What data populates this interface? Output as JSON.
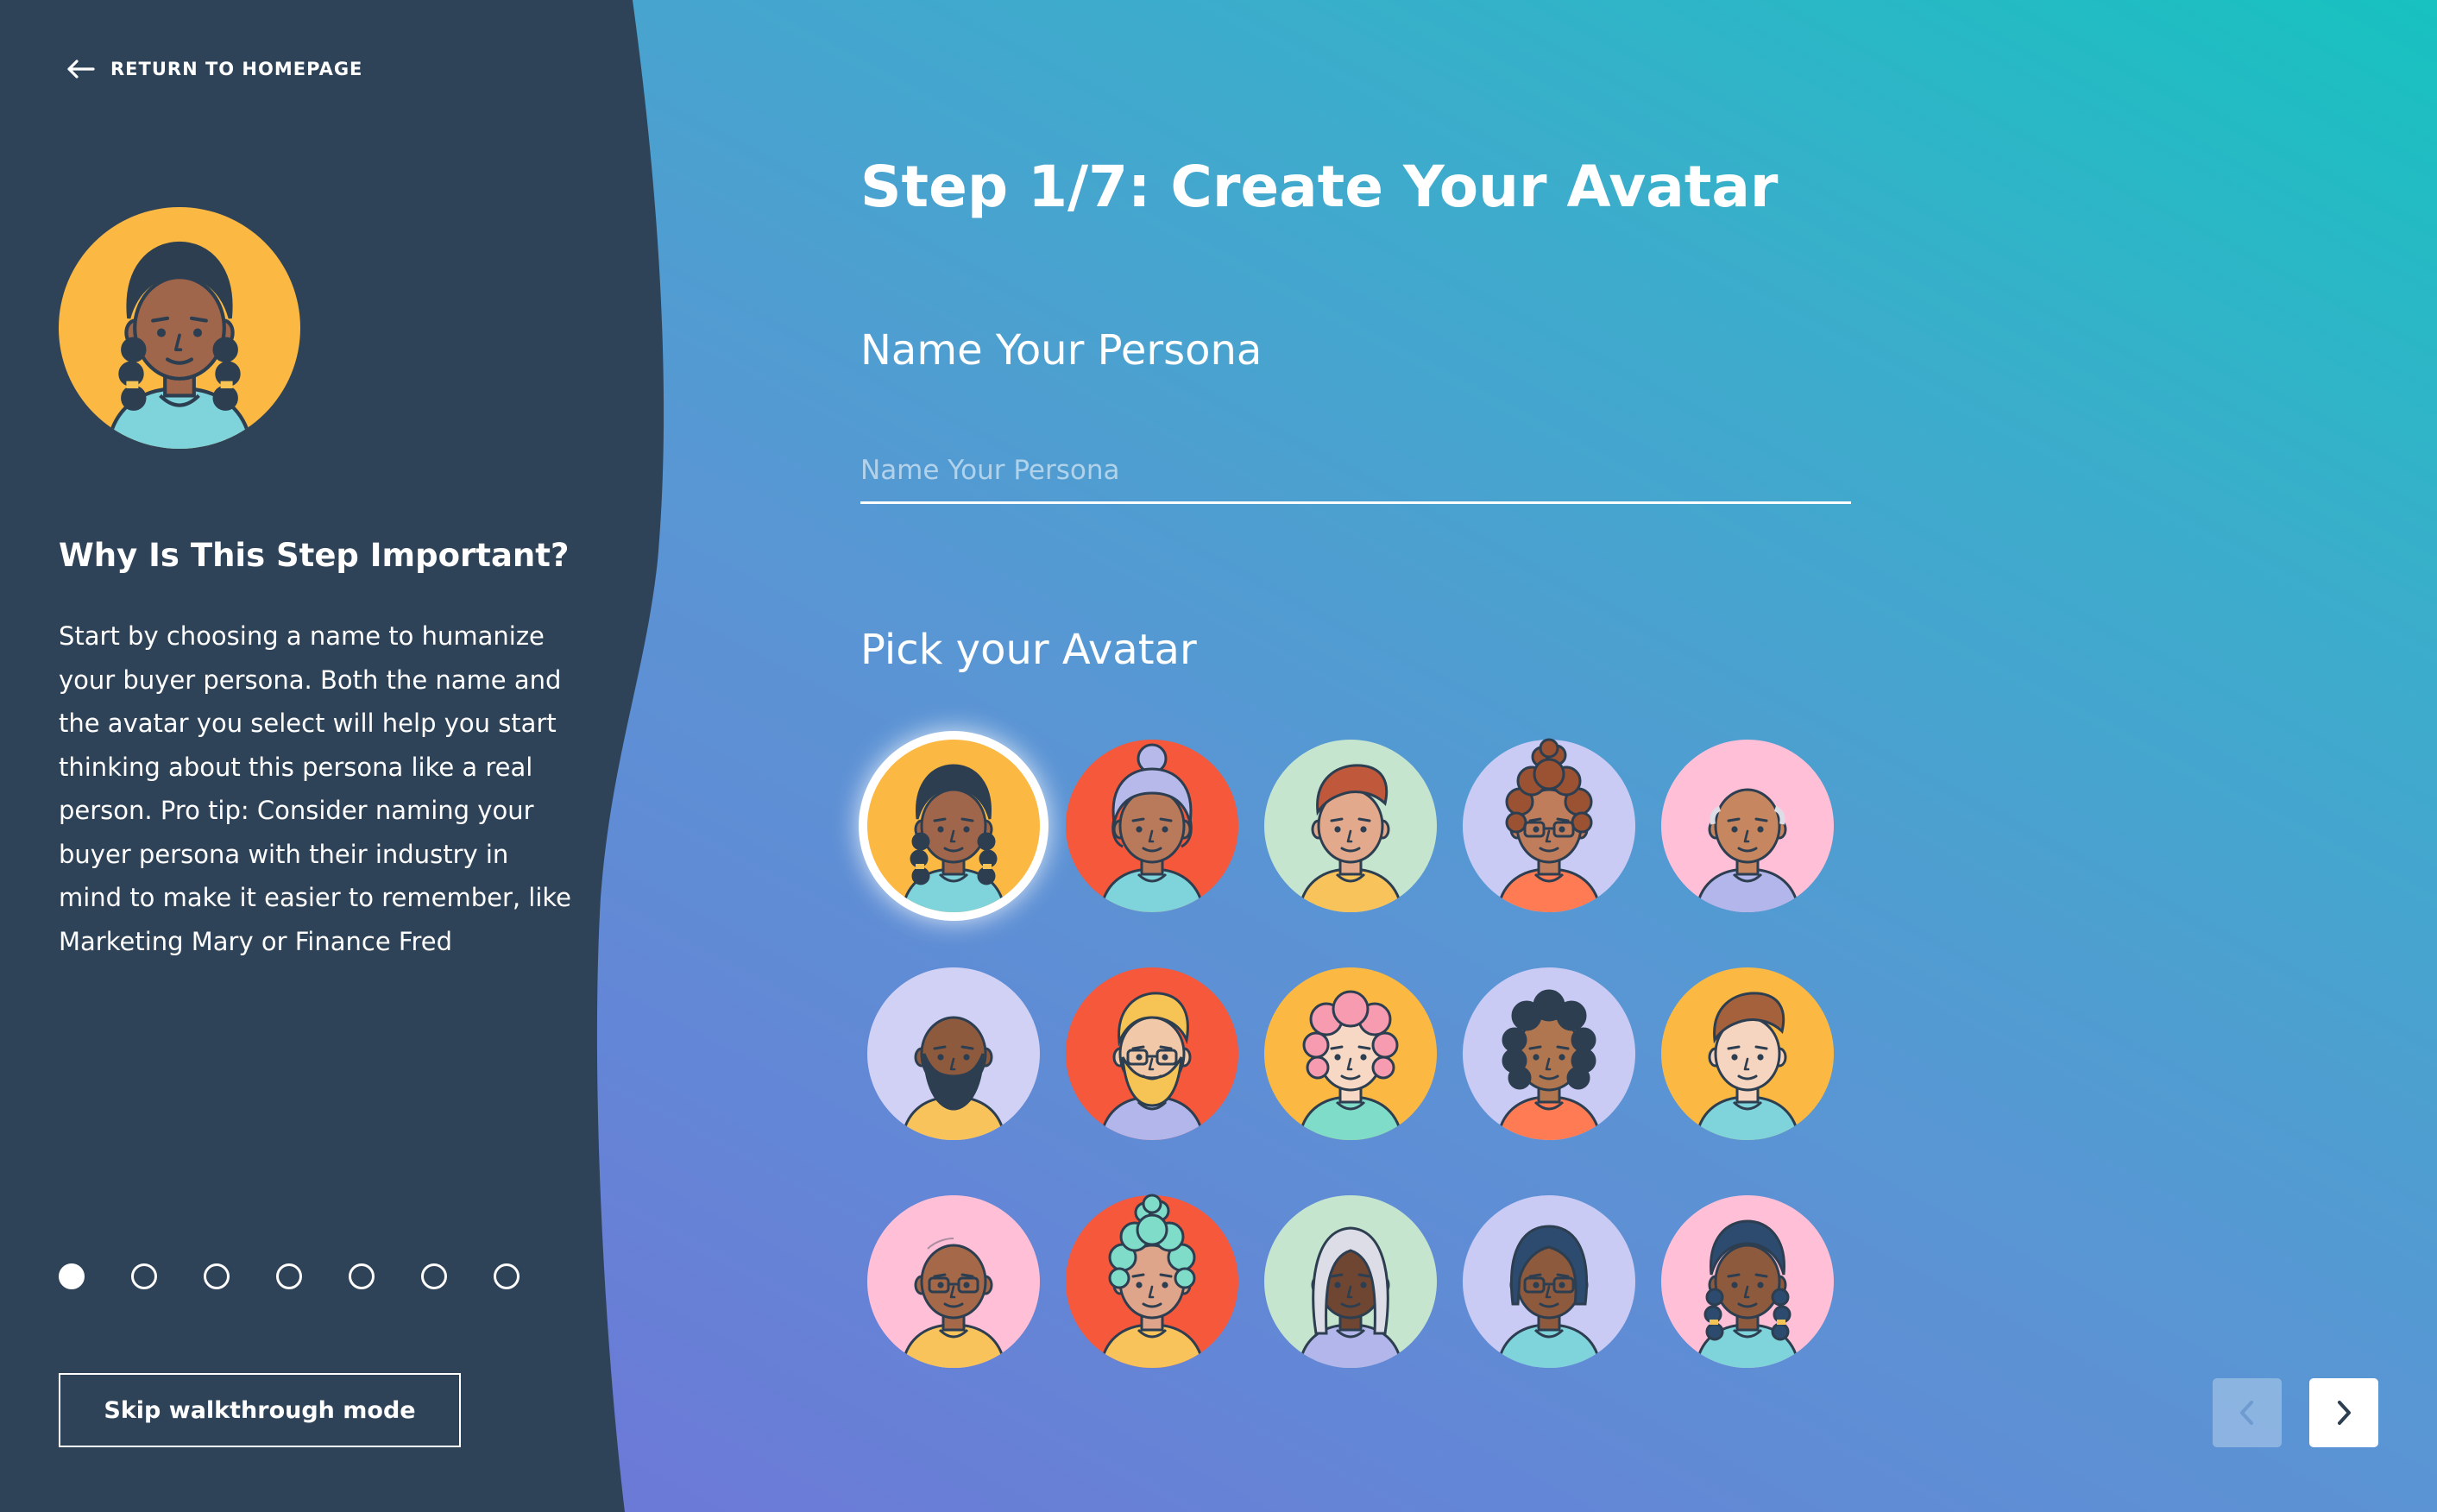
{
  "nav": {
    "return_label": "RETURN TO HOMEPAGE"
  },
  "sidebar": {
    "heading": "Why Is This Step Important?",
    "body": "Start by choosing a name to humanize your buyer persona. Both the name and the avatar you select will help you start thinking about this persona like a real person. Pro tip: Consider naming your buyer persona with their industry in mind to make it easier to remember, like Marketing Mary or Finance Fred",
    "steps_total": 7,
    "current_step": 1,
    "skip_label": "Skip walkthrough mode"
  },
  "main": {
    "title": "Step 1/7: Create Your Avatar",
    "name_heading": "Name Your Persona",
    "name_placeholder": "Name Your Persona",
    "name_value": "",
    "avatar_heading": "Pick your Avatar",
    "selected_avatar": 0,
    "avatars": [
      {
        "name": "avatar-braids-teal",
        "bg": "#fbb943",
        "skin": "#a0664b",
        "shirt": "#7fd3da",
        "hair": "#2c3e50",
        "style": "braids"
      },
      {
        "name": "avatar-gray-bun",
        "bg": "#f5583b",
        "skin": "#b97a5c",
        "shirt": "#7fd3da",
        "hair": "#b7b9eb",
        "style": "bun"
      },
      {
        "name": "avatar-red-quiff",
        "bg": "#c6e5cf",
        "skin": "#e2a98c",
        "shirt": "#f8c35b",
        "hair": "#c0583c",
        "style": "quiff"
      },
      {
        "name": "avatar-curly-glasses",
        "bg": "#c9cbf4",
        "skin": "#c07d5b",
        "shirt": "#ff7b54",
        "hair": "#9a5232",
        "style": "curlybun"
      },
      {
        "name": "avatar-bald-pink",
        "bg": "#ffc0d7",
        "skin": "#c6865f",
        "shirt": "#b3b6ea",
        "hair": "#2c3e50",
        "style": "bald"
      },
      {
        "name": "avatar-bearded",
        "bg": "#d0d1f5",
        "skin": "#8e5a3e",
        "shirt": "#f8c35b",
        "hair": "#2c3e50",
        "style": "beard"
      },
      {
        "name": "avatar-blonde-glasses",
        "bg": "#f5583b",
        "skin": "#f2c9a8",
        "shirt": "#b3b6ea",
        "hair": "#f6c454",
        "style": "blonde"
      },
      {
        "name": "avatar-pink-hair",
        "bg": "#fbb943",
        "skin": "#f6d8c5",
        "shirt": "#7fdcc8",
        "hair": "#f79bb0",
        "style": "pinkcurl"
      },
      {
        "name": "avatar-dark-curls",
        "bg": "#c9cbf4",
        "skin": "#b0764f",
        "shirt": "#ff7b54",
        "hair": "#2c3e50",
        "style": "darkcurl"
      },
      {
        "name": "avatar-brown-quiff",
        "bg": "#fbb943",
        "skin": "#f5d4c0",
        "shirt": "#7fd3da",
        "hair": "#a4613b",
        "style": "quiff"
      },
      {
        "name": "avatar-bald-glasses",
        "bg": "#ffc0d7",
        "skin": "#a5694a",
        "shirt": "#f8c35b",
        "hair": "#2c3e50",
        "style": "bald2"
      },
      {
        "name": "avatar-teal-curls",
        "bg": "#f5583b",
        "skin": "#dfa58a",
        "shirt": "#f8c35b",
        "hair": "#7fdcc8",
        "style": "curlybun"
      },
      {
        "name": "avatar-silver-long",
        "bg": "#c6e5cf",
        "skin": "#6e4632",
        "shirt": "#b3b6ea",
        "hair": "#dddde7",
        "style": "long"
      },
      {
        "name": "avatar-navy-bob",
        "bg": "#c9cbf4",
        "skin": "#8e5a3e",
        "shirt": "#7fd3da",
        "hair": "#2c4b6e",
        "style": "bob"
      },
      {
        "name": "avatar-navy-braids",
        "bg": "#ffc0d7",
        "skin": "#8e5a3e",
        "shirt": "#7fd3da",
        "hair": "#2c4b6e",
        "style": "braids"
      }
    ]
  },
  "colors": {
    "sidebar": "#2f4358",
    "gradient_top": "#17c2c0",
    "gradient_bottom": "#7270d8",
    "ink": "#2c3e50"
  }
}
